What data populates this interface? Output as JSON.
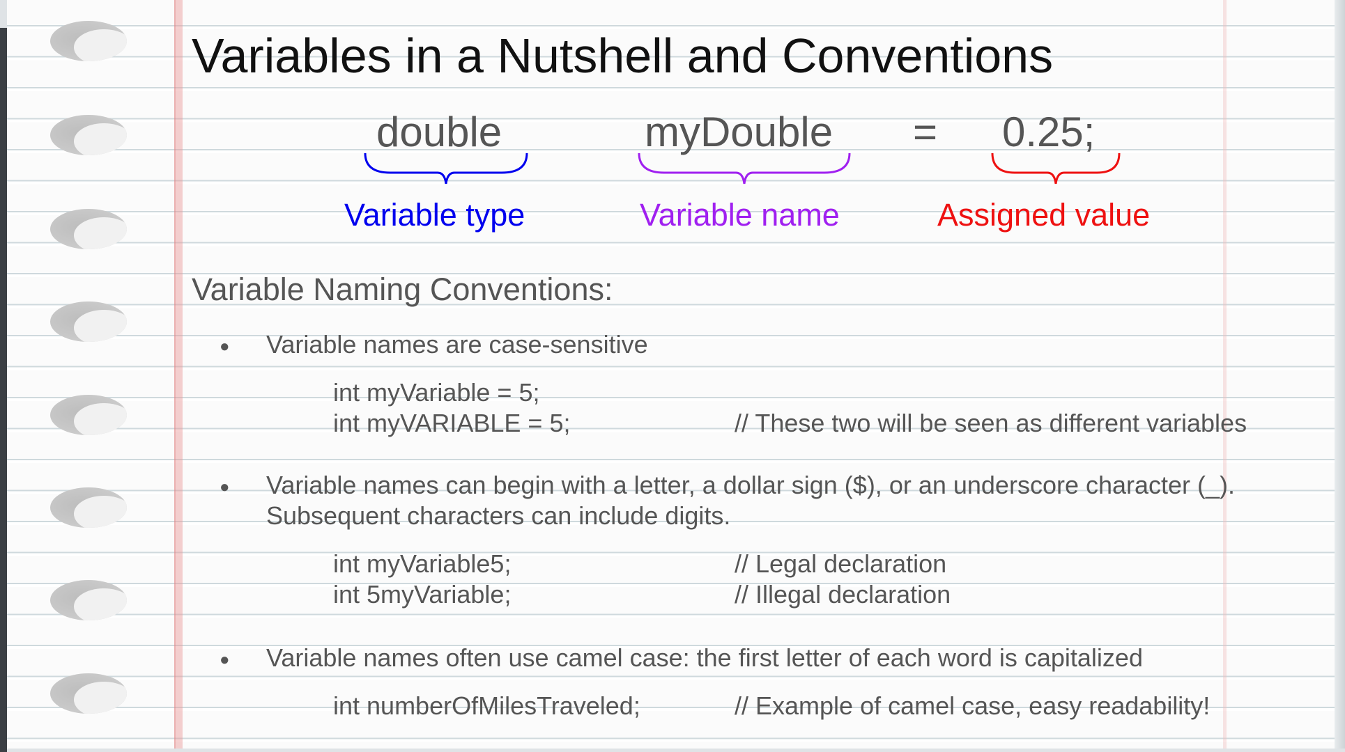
{
  "title": "Variables in a Nutshell and Conventions",
  "syntax": {
    "type_token": "double",
    "name_token": "myDouble",
    "equals_token": "=",
    "value_token": "0.25;",
    "type_caption": "Variable type",
    "name_caption": "Variable name",
    "value_caption": "Assigned value"
  },
  "colors": {
    "type": "#0000ee",
    "name": "#a020f0",
    "value": "#ee1111"
  },
  "section_heading": "Variable Naming Conventions:",
  "bullet_symbol": "●",
  "rules": [
    {
      "text": "Variable names are case-sensitive",
      "code_lines": [
        {
          "code": "int myVariable = 5;",
          "comment": ""
        },
        {
          "code": "int myVARIABLE = 5;",
          "comment": "// These two will be seen as different variables"
        }
      ]
    },
    {
      "text_line1": "Variable names can begin with a letter, a dollar sign ($), or an underscore character (_).",
      "text_line2": "Subsequent characters can include digits.",
      "code_lines": [
        {
          "code": "int myVariable5;",
          "comment": "// Legal declaration"
        },
        {
          "code": "int 5myVariable;",
          "comment": "// Illegal declaration"
        }
      ]
    },
    {
      "text": "Variable names often use camel case: the first letter of each word is capitalized",
      "code_lines": [
        {
          "code": "int numberOfMilesTraveled;",
          "comment": "// Example of camel case, easy readability!"
        }
      ]
    }
  ]
}
